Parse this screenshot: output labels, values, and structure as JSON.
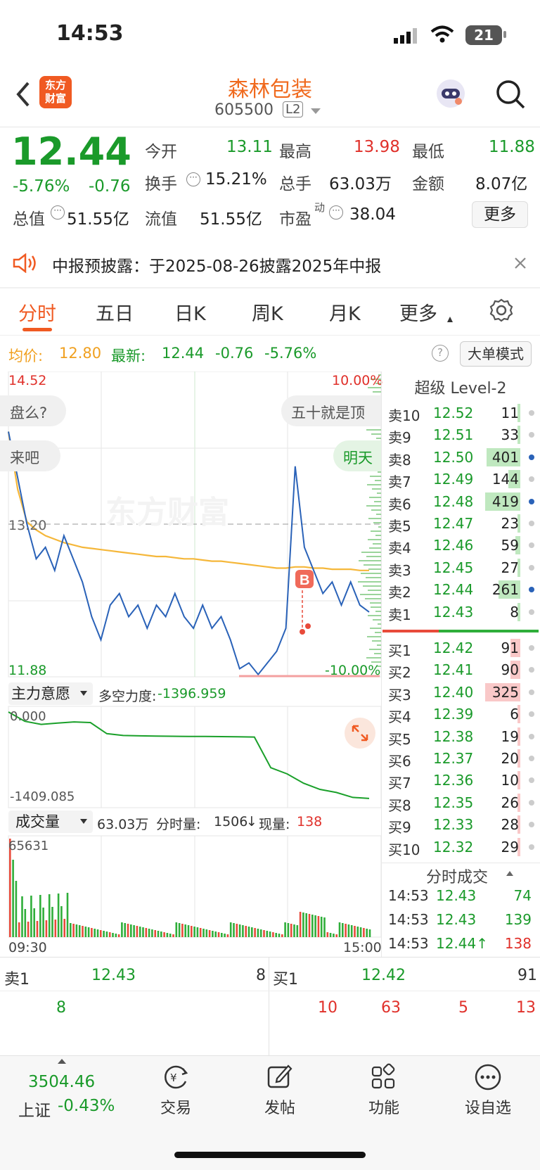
{
  "status_bar": {
    "time": "14:53",
    "battery": "21"
  },
  "header": {
    "brand_line1": "东方",
    "brand_line2": "财富",
    "stock_name": "森林包装",
    "stock_code": "605500",
    "level_badge": "L2"
  },
  "quote": {
    "price": "12.44",
    "change_pct": "-5.76%",
    "change": "-0.76",
    "open_label": "今开",
    "open": "13.11",
    "high_label": "最高",
    "high": "13.98",
    "low_label": "最低",
    "low": "11.88",
    "turnover_label": "换手",
    "turnover": "15.21%",
    "volume_label": "总手",
    "volume": "63.03万",
    "amount_label": "金额",
    "amount": "8.07亿",
    "mktcap_label": "总值",
    "mktcap": "51.55亿",
    "float_label": "流值",
    "float_cap": "51.55亿",
    "pe_label": "市盈",
    "pe_sup": "动",
    "pe": "38.04",
    "more_button": "更多"
  },
  "notice": {
    "text": "中报预披露：于2025-08-26披露2025年中报"
  },
  "tabs": [
    {
      "label": "分时",
      "active": true
    },
    {
      "label": "五日"
    },
    {
      "label": "日K"
    },
    {
      "label": "周K"
    },
    {
      "label": "月K"
    },
    {
      "label": "更多"
    }
  ],
  "info_line": {
    "avg_label": "均价:",
    "avg": "12.80",
    "latest_label": "最新:",
    "latest": "12.44",
    "change": "-0.76",
    "pct": "-5.76%",
    "mode_button": "大单模式"
  },
  "chart": {
    "top_price": "14.52",
    "bottom_price": "11.88",
    "ref_price": "13.20",
    "top_pct": "10.00%",
    "bottom_pct": "-10.00%",
    "watermark": "东方财富",
    "start_time": "09:30",
    "end_time": "15:00",
    "bubbles": [
      "盘么?",
      "五十就是顶",
      "来吧",
      "明天"
    ],
    "marker": "B"
  },
  "chart_data": {
    "type": "line",
    "series": [
      {
        "name": "最新",
        "values": [
          14.0,
          13.6,
          13.2,
          12.9,
          13.0,
          12.8,
          13.1,
          12.9,
          12.7,
          12.4,
          12.2,
          12.5,
          12.6,
          12.4,
          12.5,
          12.3,
          12.5,
          12.4,
          12.6,
          12.4,
          12.3,
          12.5,
          12.3,
          12.4,
          12.2,
          11.95,
          12.0,
          11.9,
          12.0,
          12.1,
          12.3,
          13.7,
          13.0,
          12.8,
          12.6,
          12.7,
          12.5,
          12.7,
          12.5,
          12.44
        ]
      },
      {
        "name": "均价",
        "values": [
          14.0,
          13.5,
          13.22,
          13.15,
          13.1,
          13.07,
          13.04,
          13.02,
          13.0,
          12.99,
          12.98,
          12.97,
          12.96,
          12.95,
          12.94,
          12.93,
          12.92,
          12.92,
          12.91,
          12.9,
          12.9,
          12.89,
          12.88,
          12.88,
          12.87,
          12.86,
          12.85,
          12.84,
          12.83,
          12.82,
          12.82,
          12.83,
          12.83,
          12.82,
          12.82,
          12.81,
          12.81,
          12.81,
          12.8,
          12.8
        ]
      }
    ],
    "ylim": [
      11.88,
      14.52
    ]
  },
  "indicator": {
    "dropdown": "主力意愿",
    "label": "多空力度:",
    "value": "-1396.959",
    "top": "0.000",
    "bottom": "-1409.085",
    "values": [
      0,
      -150,
      -200,
      -180,
      -160,
      -170,
      -350,
      -380,
      -385,
      -390,
      -392,
      -395,
      -395,
      -398,
      -400,
      -405,
      -900,
      -1000,
      -1150,
      -1250,
      -1300,
      -1380,
      -1397
    ]
  },
  "volume": {
    "dropdown": "成交量",
    "total": "63.03万",
    "tick_label": "分时量:",
    "tick": "1506",
    "tick_arrow": "↓",
    "now_label": "现量:",
    "now": "138",
    "max": "65631"
  },
  "orderbook": {
    "title": "超级 Level-2",
    "asks": [
      {
        "label": "卖10",
        "price": "12.52",
        "qty": "11",
        "bar": 0.03
      },
      {
        "label": "卖9",
        "price": "12.51",
        "qty": "33",
        "bar": 0.08
      },
      {
        "label": "卖8",
        "price": "12.50",
        "qty": "401",
        "bar": 0.96
      },
      {
        "label": "卖7",
        "price": "12.49",
        "qty": "144",
        "bar": 0.34
      },
      {
        "label": "卖6",
        "price": "12.48",
        "qty": "419",
        "bar": 1.0
      },
      {
        "label": "卖5",
        "price": "12.47",
        "qty": "23",
        "bar": 0.06
      },
      {
        "label": "卖4",
        "price": "12.46",
        "qty": "59",
        "bar": 0.14
      },
      {
        "label": "卖3",
        "price": "12.45",
        "qty": "27",
        "bar": 0.07
      },
      {
        "label": "卖2",
        "price": "12.44",
        "qty": "261",
        "bar": 0.62
      },
      {
        "label": "卖1",
        "price": "12.43",
        "qty": "8",
        "bar": 0.02
      }
    ],
    "bids": [
      {
        "label": "买1",
        "price": "12.42",
        "qty": "91",
        "bar": 0.28
      },
      {
        "label": "买2",
        "price": "12.41",
        "qty": "90",
        "bar": 0.28
      },
      {
        "label": "买3",
        "price": "12.40",
        "qty": "325",
        "bar": 1.0
      },
      {
        "label": "买4",
        "price": "12.39",
        "qty": "6",
        "bar": 0.02
      },
      {
        "label": "买5",
        "price": "12.38",
        "qty": "19",
        "bar": 0.06
      },
      {
        "label": "买6",
        "price": "12.37",
        "qty": "20",
        "bar": 0.06
      },
      {
        "label": "买7",
        "price": "12.36",
        "qty": "10",
        "bar": 0.03
      },
      {
        "label": "买8",
        "price": "12.35",
        "qty": "26",
        "bar": 0.08
      },
      {
        "label": "买9",
        "price": "12.33",
        "qty": "28",
        "bar": 0.09
      },
      {
        "label": "买10",
        "price": "12.32",
        "qty": "29",
        "bar": 0.09
      }
    ],
    "ticks_title": "分时成交",
    "ticks": [
      {
        "time": "14:53",
        "price": "12.43",
        "qty": "74"
      },
      {
        "time": "14:53",
        "price": "12.43",
        "qty": "139"
      },
      {
        "time": "14:53",
        "price": "12.44↑",
        "qty": "138"
      }
    ]
  },
  "bottom_book": {
    "sell_label": "卖1",
    "sell_price": "12.43",
    "sell_qty": "8",
    "buy_label": "买1",
    "buy_price": "12.42",
    "buy_qty": "91",
    "sell_queue": [
      "8"
    ],
    "buy_queue": [
      "10",
      "63",
      "5",
      "13"
    ]
  },
  "nav": {
    "index_value": "3504.46",
    "index_name": "上证",
    "index_pct": "-0.43%",
    "items": [
      "交易",
      "发帖",
      "功能",
      "设自选"
    ]
  }
}
